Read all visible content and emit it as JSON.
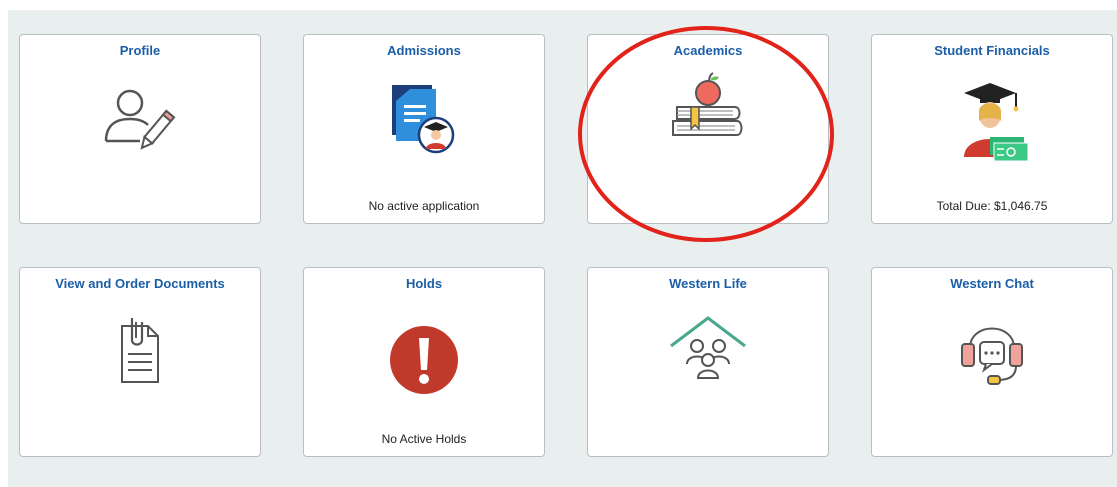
{
  "tiles": [
    {
      "title": "Profile",
      "footer": "",
      "icon": "profile-edit-icon"
    },
    {
      "title": "Admissions",
      "footer": "No active application",
      "icon": "admissions-document-icon"
    },
    {
      "title": "Academics",
      "footer": "",
      "icon": "apple-books-icon"
    },
    {
      "title": "Student Financials",
      "footer": "Total Due:  $1,046.75",
      "icon": "graduate-money-icon"
    },
    {
      "title": "View and Order Documents",
      "footer": "",
      "icon": "clipboard-document-icon"
    },
    {
      "title": "Holds",
      "footer": "No Active Holds",
      "icon": "exclamation-alert-icon"
    },
    {
      "title": "Western Life",
      "footer": "",
      "icon": "house-people-icon"
    },
    {
      "title": "Western Chat",
      "footer": "",
      "icon": "headset-chat-icon"
    }
  ],
  "colors": {
    "title": "#1b5ea8",
    "annotation": "#e2231a",
    "hold": "#c0392b"
  }
}
